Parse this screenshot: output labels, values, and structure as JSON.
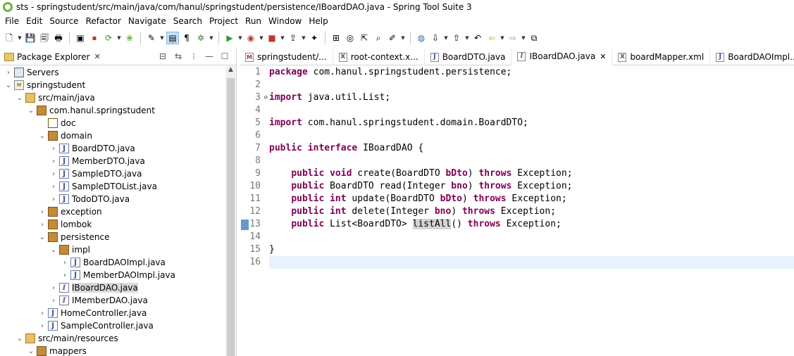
{
  "window": {
    "title": "sts - springstudent/src/main/java/com/hanul/springstudent/persistence/IBoardDAO.java - Spring Tool Suite 3"
  },
  "menu": [
    "File",
    "Edit",
    "Source",
    "Refactor",
    "Navigate",
    "Search",
    "Project",
    "Run",
    "Window",
    "Help"
  ],
  "toolbar": {
    "icons": [
      "new-icon",
      "save-icon",
      "save-all-icon",
      "print-icon",
      "terminal-icon",
      "stop-icon",
      "refresh-icon",
      "spring-icon",
      "mark-occurrences-icon",
      "block-selection-icon",
      "show-whitespace-icon",
      "debug-icon",
      "run-icon",
      "coverage-icon",
      "stop-server-icon",
      "deploy-icon",
      "new-type-icon",
      "new-package-icon",
      "new-class-icon",
      "open-type-icon",
      "search-icon",
      "pin-icon",
      "globe-icon",
      "next-annotation-icon",
      "prev-annotation-icon",
      "last-edit-icon",
      "back-icon",
      "forward-icon",
      "open-perspective-icon"
    ]
  },
  "explorer": {
    "title": "Package Explorer",
    "tree": [
      {
        "label": "Servers",
        "icon": "server-icon",
        "depth": 0,
        "twisty": "›"
      },
      {
        "label": "springstudent",
        "icon": "project-icon",
        "depth": 0,
        "twisty": "⌄"
      },
      {
        "label": "src/main/java",
        "icon": "source-folder-icon",
        "depth": 1,
        "twisty": "⌄"
      },
      {
        "label": "com.hanul.springstudent",
        "icon": "package-icon",
        "depth": 2,
        "twisty": "⌄"
      },
      {
        "label": "doc",
        "icon": "empty-package-icon",
        "depth": 3,
        "twisty": ""
      },
      {
        "label": "domain",
        "icon": "package-icon",
        "depth": 3,
        "twisty": "⌄"
      },
      {
        "label": "BoardDTO.java",
        "icon": "java-file-icon",
        "depth": 4,
        "twisty": "›"
      },
      {
        "label": "MemberDTO.java",
        "icon": "java-file-icon",
        "depth": 4,
        "twisty": "›"
      },
      {
        "label": "SampleDTO.java",
        "icon": "java-file-icon",
        "depth": 4,
        "twisty": "›"
      },
      {
        "label": "SampleDTOList.java",
        "icon": "java-file-icon",
        "depth": 4,
        "twisty": "›"
      },
      {
        "label": "TodoDTO.java",
        "icon": "java-file-icon",
        "depth": 4,
        "twisty": "›"
      },
      {
        "label": "exception",
        "icon": "package-icon",
        "depth": 3,
        "twisty": "›"
      },
      {
        "label": "lombok",
        "icon": "package-icon",
        "depth": 3,
        "twisty": "›"
      },
      {
        "label": "persistence",
        "icon": "package-icon",
        "depth": 3,
        "twisty": "⌄"
      },
      {
        "label": "impl",
        "icon": "package-icon",
        "depth": 4,
        "twisty": "⌄"
      },
      {
        "label": "BoardDAOImpl.java",
        "icon": "java-file-icon",
        "depth": 5,
        "twisty": "›"
      },
      {
        "label": "MemberDAOImpl.java",
        "icon": "java-file-icon",
        "depth": 5,
        "twisty": "›"
      },
      {
        "label": "IBoardDAO.java",
        "icon": "interface-file-icon",
        "depth": 4,
        "twisty": "›",
        "selected": true
      },
      {
        "label": "IMemberDAO.java",
        "icon": "interface-file-icon",
        "depth": 4,
        "twisty": "›"
      },
      {
        "label": "HomeController.java",
        "icon": "java-file-icon",
        "depth": 3,
        "twisty": "›"
      },
      {
        "label": "SampleController.java",
        "icon": "java-file-icon",
        "depth": 3,
        "twisty": "›"
      },
      {
        "label": "src/main/resources",
        "icon": "source-folder-icon",
        "depth": 1,
        "twisty": "⌄"
      },
      {
        "label": "mappers",
        "icon": "package-icon",
        "depth": 2,
        "twisty": "⌄"
      }
    ]
  },
  "editor": {
    "tabs": [
      {
        "label": "springstudent/...",
        "type": "mybatis",
        "active": false
      },
      {
        "label": "root-context.x...",
        "type": "xml",
        "active": false
      },
      {
        "label": "BoardDTO.java",
        "type": "java",
        "active": false
      },
      {
        "label": "IBoardDAO.java",
        "type": "iface",
        "active": true
      },
      {
        "label": "boardMapper.xml",
        "type": "xml",
        "active": false
      },
      {
        "label": "BoardDAOImpl....",
        "type": "java",
        "active": false
      }
    ],
    "lines": [
      {
        "num": "1",
        "tokens": [
          [
            "kw",
            "package"
          ],
          [
            "t",
            " com.hanul.springstudent.persistence;"
          ]
        ]
      },
      {
        "num": "2",
        "tokens": []
      },
      {
        "num": "3",
        "fold": "⊖",
        "tokens": [
          [
            "kw",
            "import"
          ],
          [
            "t",
            " java.util.List;"
          ]
        ]
      },
      {
        "num": "4",
        "tokens": []
      },
      {
        "num": "5",
        "tokens": [
          [
            "kw",
            "import"
          ],
          [
            "t",
            " com.hanul.springstudent.domain.BoardDTO;"
          ]
        ]
      },
      {
        "num": "6",
        "tokens": []
      },
      {
        "num": "7",
        "tokens": [
          [
            "kw",
            "public"
          ],
          [
            "t",
            " "
          ],
          [
            "kw",
            "interface"
          ],
          [
            "t",
            " IBoardDAO {"
          ]
        ]
      },
      {
        "num": "8",
        "tokens": []
      },
      {
        "num": "9",
        "tokens": [
          [
            "t",
            "    "
          ],
          [
            "kw",
            "public"
          ],
          [
            "t",
            " "
          ],
          [
            "kw",
            "void"
          ],
          [
            "t",
            " create(BoardDTO "
          ],
          [
            "kw",
            "bDto"
          ],
          [
            "t",
            ") "
          ],
          [
            "kw",
            "throws"
          ],
          [
            "t",
            " Exception;"
          ]
        ]
      },
      {
        "num": "10",
        "tokens": [
          [
            "t",
            "    "
          ],
          [
            "kw",
            "public"
          ],
          [
            "t",
            " BoardDTO read(Integer "
          ],
          [
            "kw",
            "bno"
          ],
          [
            "t",
            ") "
          ],
          [
            "kw",
            "throws"
          ],
          [
            "t",
            " Exception;"
          ]
        ]
      },
      {
        "num": "11",
        "tokens": [
          [
            "t",
            "    "
          ],
          [
            "kw",
            "public"
          ],
          [
            "t",
            " "
          ],
          [
            "kw",
            "int"
          ],
          [
            "t",
            " update(BoardDTO "
          ],
          [
            "kw",
            "bDto"
          ],
          [
            "t",
            ") "
          ],
          [
            "kw",
            "throws"
          ],
          [
            "t",
            " Exception;"
          ]
        ]
      },
      {
        "num": "12",
        "tokens": [
          [
            "t",
            "    "
          ],
          [
            "kw",
            "public"
          ],
          [
            "t",
            " "
          ],
          [
            "kw",
            "int"
          ],
          [
            "t",
            " delete(Integer "
          ],
          [
            "kw",
            "bno"
          ],
          [
            "t",
            ") "
          ],
          [
            "kw",
            "throws"
          ],
          [
            "t",
            " Exception;"
          ]
        ]
      },
      {
        "num": "13",
        "marked": true,
        "tokens": [
          [
            "t",
            "    "
          ],
          [
            "kw",
            "public"
          ],
          [
            "t",
            " List<BoardDTO> "
          ],
          [
            "hl",
            "listAll"
          ],
          [
            "t",
            "() "
          ],
          [
            "kw",
            "throws"
          ],
          [
            "t",
            " Exception;"
          ]
        ]
      },
      {
        "num": "14",
        "tokens": []
      },
      {
        "num": "15",
        "tokens": [
          [
            "t",
            "}"
          ]
        ]
      },
      {
        "num": "16",
        "current": true,
        "tokens": []
      }
    ]
  }
}
